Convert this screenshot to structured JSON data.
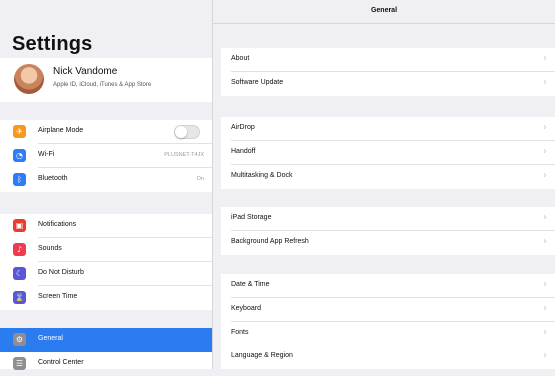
{
  "sidebar": {
    "title": "Settings",
    "profile": {
      "name": "Nick Vandome",
      "subtitle": "Apple ID, iCloud, iTunes & App Store"
    },
    "items": [
      {
        "label": "Airplane Mode",
        "icon": "airplane-icon",
        "color": "#f7991e",
        "toggle": true,
        "toggle_on": false
      },
      {
        "label": "Wi-Fi",
        "icon": "wifi-icon",
        "color": "#2f7cf6",
        "value": "PLUSNET-T4JX"
      },
      {
        "label": "Bluetooth",
        "icon": "bluetooth-icon",
        "color": "#2f7cf6",
        "value": "On"
      },
      {
        "label": "Notifications",
        "icon": "notifications-icon",
        "color": "#ee3b30"
      },
      {
        "label": "Sounds",
        "icon": "sounds-icon",
        "color": "#ee3b4f"
      },
      {
        "label": "Do Not Disturb",
        "icon": "moon-icon",
        "color": "#5a56d6"
      },
      {
        "label": "Screen Time",
        "icon": "hourglass-icon",
        "color": "#5a56d6"
      },
      {
        "label": "General",
        "icon": "gear-icon",
        "color": "#8e8e93",
        "selected": true
      },
      {
        "label": "Control Center",
        "icon": "control-center-icon",
        "color": "#8e8e93"
      }
    ]
  },
  "main": {
    "title": "General",
    "groups": [
      [
        "About",
        "Software Update"
      ],
      [
        "AirDrop",
        "Handoff",
        "Multitasking & Dock"
      ],
      [
        "iPad Storage",
        "Background App Refresh"
      ],
      [
        "Date & Time",
        "Keyboard",
        "Fonts",
        "Language & Region"
      ]
    ]
  }
}
